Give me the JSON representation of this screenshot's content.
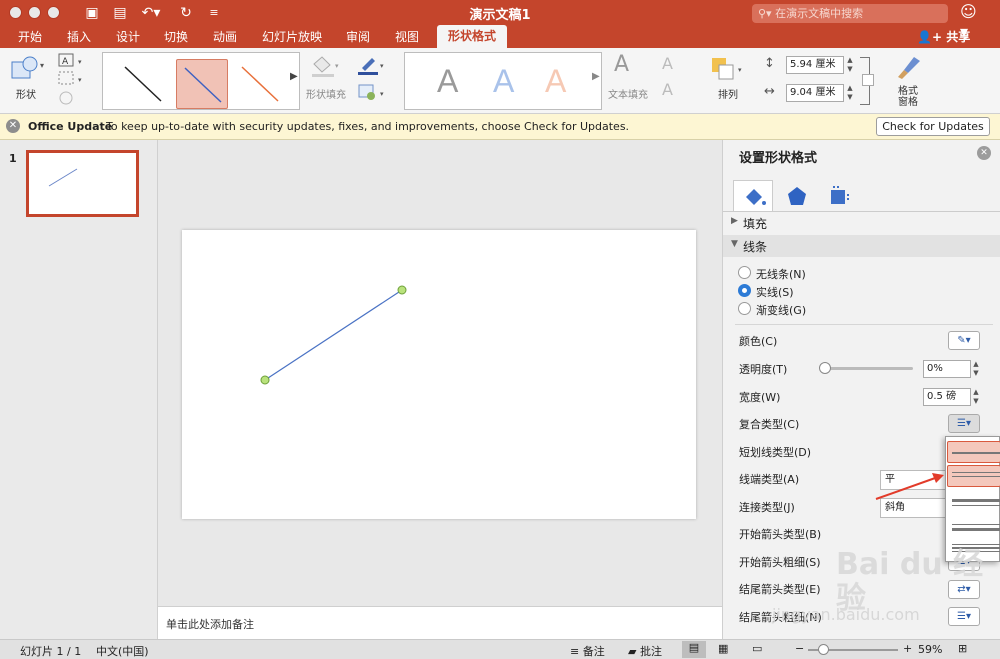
{
  "app": {
    "document_title": "演示文稿1",
    "search_placeholder": "在演示文稿中搜索",
    "share_label": "共享"
  },
  "tabs": [
    "开始",
    "插入",
    "设计",
    "切换",
    "动画",
    "幻灯片放映",
    "审阅",
    "视图"
  ],
  "active_tab": "形状格式",
  "ribbon": {
    "shape_label": "形状",
    "shape_fill_label": "形状填充",
    "text_fill_label": "文本填充",
    "arrange_label": "排列",
    "format_pane_label": "格式窗格",
    "height_value": "5.94 厘米",
    "width_value": "9.04 厘米",
    "wordart_letter": "A",
    "accent_color": "#c4452c"
  },
  "infobar": {
    "title": "Office Update",
    "message": "To keep up-to-date with security updates, fixes, and improvements, choose Check for Updates.",
    "button": "Check for Updates"
  },
  "thumbnails": [
    {
      "number": "1"
    }
  ],
  "notes_placeholder": "单击此处添加备注",
  "pane": {
    "title": "设置形状格式",
    "fill_section": "填充",
    "line_section": "线条",
    "radios": [
      {
        "label": "无线条(N)",
        "checked": false
      },
      {
        "label": "实线(S)",
        "checked": true
      },
      {
        "label": "渐变线(G)",
        "checked": false
      }
    ],
    "color_label": "颜色(C)",
    "transparency_label": "透明度(T)",
    "transparency_value": "0%",
    "width_label": "宽度(W)",
    "width_value": "0.5 磅",
    "compound_label": "复合类型(C)",
    "dash_label": "短划线类型(D)",
    "cap_label": "线端类型(A)",
    "cap_value": "平",
    "join_label": "连接类型(J)",
    "join_value": "斜角",
    "begin_arrow_type": "开始箭头类型(B)",
    "begin_arrow_size": "开始箭头粗细(S)",
    "end_arrow_type": "结尾箭头类型(E)",
    "end_arrow_size": "结尾箭头粗细(N)"
  },
  "status": {
    "slide_info": "幻灯片 1 / 1",
    "language": "中文(中国)",
    "notes_btn": "备注",
    "comments_btn": "批注",
    "zoom": "59%"
  },
  "watermark": {
    "brand": "Bai du 经验",
    "url": "jingyan.baidu.com"
  }
}
